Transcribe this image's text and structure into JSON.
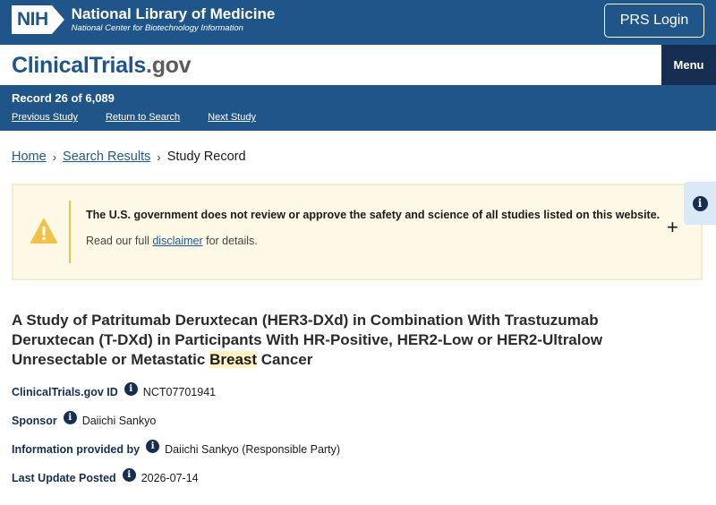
{
  "nih_header": {
    "logo_mark": "NIH",
    "title": "National Library of Medicine",
    "subtitle": "National Center for Biotechnology Information",
    "login_button": "PRS Login"
  },
  "site_header": {
    "logo_main": "ClinicalTrials",
    "logo_suffix": ".gov",
    "menu_button": "Menu"
  },
  "record_nav": {
    "count_text": "Record 26 of 6,089",
    "previous": "Previous Study",
    "return": "Return to Search",
    "next": "Next Study"
  },
  "breadcrumb": {
    "home": "Home",
    "results": "Search Results",
    "current": "Study Record",
    "separator": "›"
  },
  "info_tab": {
    "icon": "i"
  },
  "disclaimer": {
    "headline": "The U.S. government does not review or approve the safety and science of all studies listed on this website.",
    "detail_prefix": "Read our full ",
    "detail_link": "disclaimer",
    "detail_suffix": " for details.",
    "expand_symbol": "+"
  },
  "study": {
    "title_part1": "A Study of Patritumab Deruxtecan (HER3-DXd) in Combination With Trastuzumab Deruxtecan (T-DXd) in Participants With HR-Positive, HER2-Low or HER2-Ultralow Unresectable or Metastatic ",
    "title_highlight": "Breast",
    "title_part2": " Cancer",
    "fields": {
      "id_label": "ClinicalTrials.gov ID",
      "id_value": "NCT07701941",
      "sponsor_label": "Sponsor",
      "sponsor_value": "Daiichi Sankyo",
      "provided_label": "Information provided by",
      "provided_value": "Daiichi Sankyo (Responsible Party)",
      "updated_label": "Last Update Posted",
      "updated_value": "2026-07-14"
    },
    "info_icon": "i"
  },
  "colors": {
    "nih_blue": "#20558a",
    "navy": "#162e51",
    "link": "#1a5a96",
    "alert_bg": "#fef9e6",
    "warning": "#f0c24a"
  }
}
